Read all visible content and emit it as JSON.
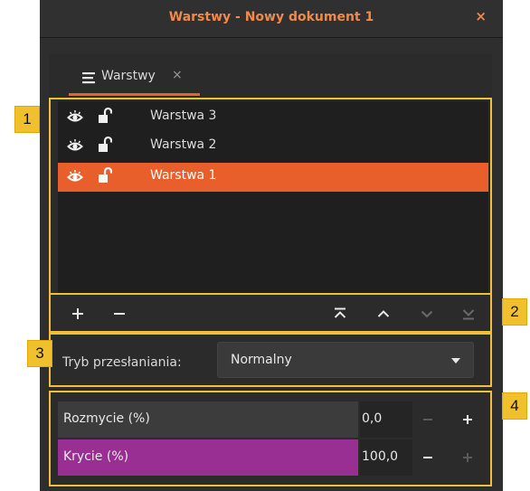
{
  "window": {
    "title": "Warstwy - Nowy dokument 1",
    "close_glyph": "×"
  },
  "tab": {
    "label": "Warstwy",
    "close_glyph": "×",
    "icon": "layers-icon"
  },
  "layers": [
    {
      "name": "Warstwa 3",
      "visible": true,
      "locked": false,
      "selected": false
    },
    {
      "name": "Warstwa 2",
      "visible": true,
      "locked": false,
      "selected": false
    },
    {
      "name": "Warstwa 1",
      "visible": true,
      "locked": false,
      "selected": true
    }
  ],
  "toolbar": {
    "buttons": [
      "add-layer",
      "remove-layer",
      "move-to-top",
      "move-up",
      "move-down",
      "move-to-bottom"
    ]
  },
  "blend": {
    "label": "Tryb przesłaniania:",
    "value": "Normalny"
  },
  "blur": {
    "label": "Rozmycie (%)",
    "value": "0,0",
    "fraction": 0
  },
  "opacity": {
    "label": "Krycie (%)",
    "value": "100,0",
    "fraction": 1
  },
  "annotations": [
    "1",
    "2",
    "3",
    "4"
  ],
  "colors": {
    "accent": "#e95f2c",
    "title": "#f08a4a",
    "opacity_fill": "#9a2f93",
    "annotation": "#f0c02e"
  }
}
